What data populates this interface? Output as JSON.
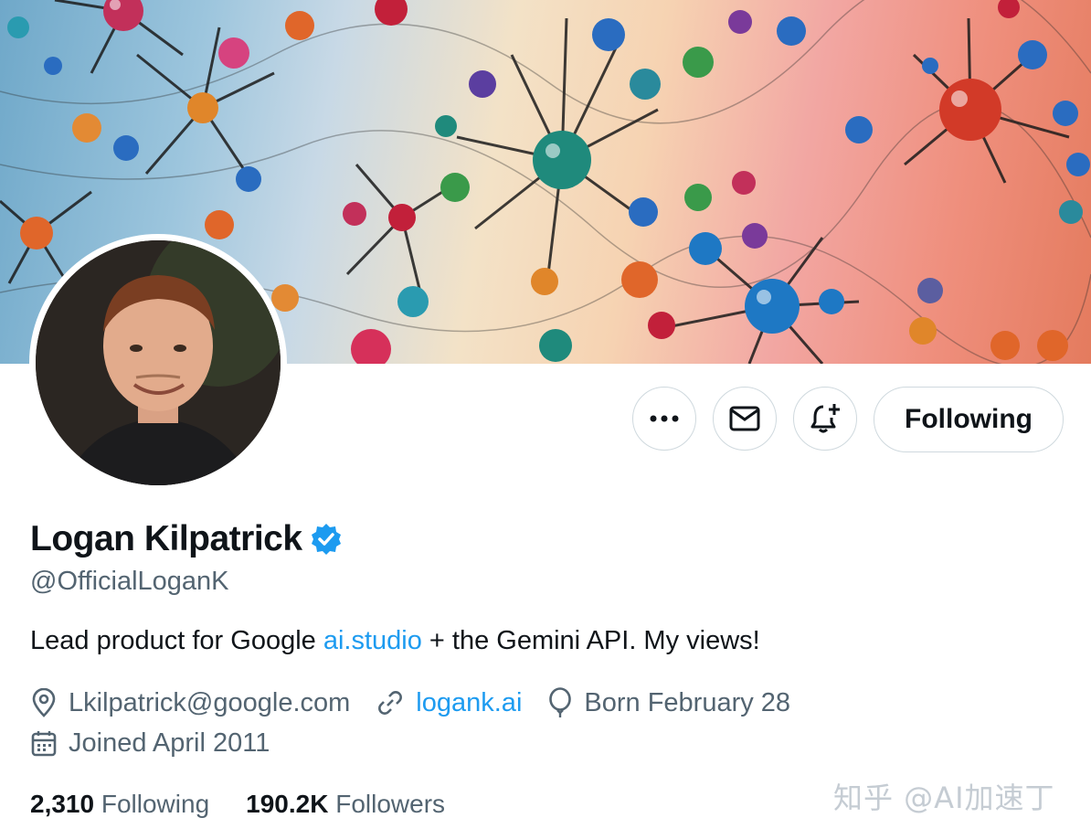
{
  "profile": {
    "display_name": "Logan Kilpatrick",
    "handle": "@OfficialLoganK",
    "bio_prefix": "Lead product for Google ",
    "bio_link": "ai.studio",
    "bio_suffix": " + the Gemini API. My views!",
    "email": "Lkilpatrick@google.com",
    "website": "logank.ai",
    "birthday": "Born February 28",
    "joined": "Joined April 2011"
  },
  "actions": {
    "follow_label": "Following",
    "more_icon": "more-icon",
    "message_icon": "mail-icon",
    "notify_icon": "bell-plus-icon"
  },
  "stats": {
    "following_count": "2,310",
    "following_label": "Following",
    "followers_count": "190.2K",
    "followers_label": "Followers"
  },
  "watermark": "知乎 @AI加速丁",
  "colors": {
    "link": "#1d9bf0",
    "verified": "#1d9bf0",
    "secondary_text": "#536471",
    "border": "#cfd9de"
  }
}
